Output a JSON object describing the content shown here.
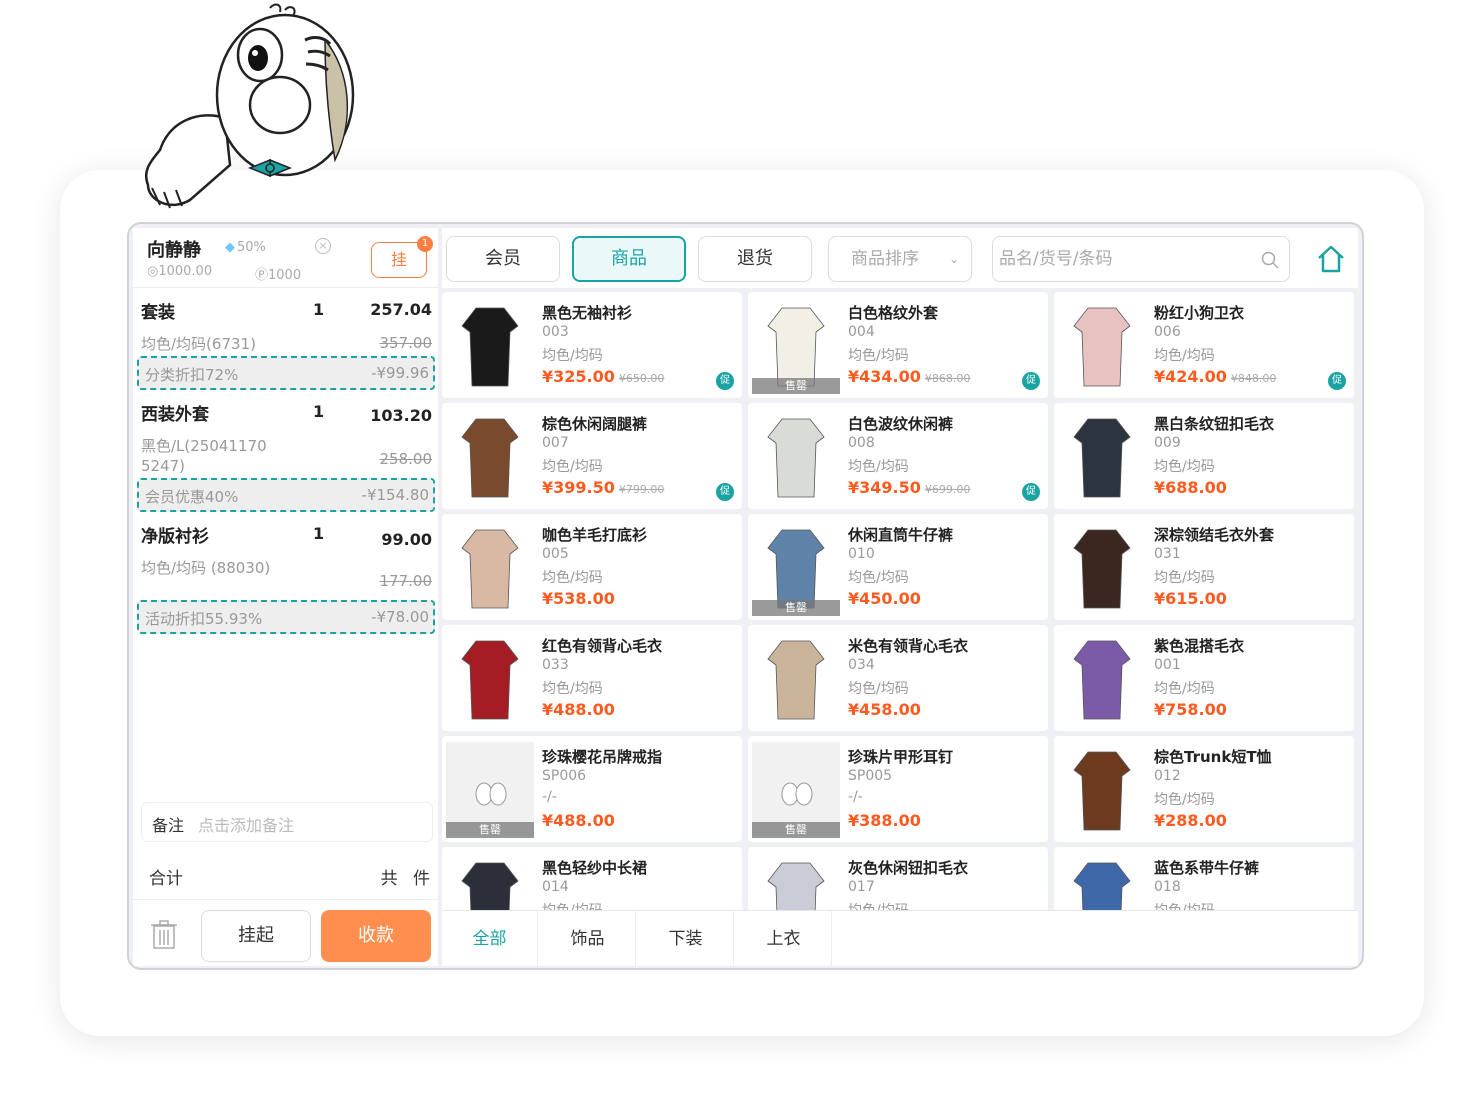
{
  "member": {
    "name": "向静静",
    "discount": "50%",
    "balance": "1000.00",
    "points": "1000",
    "hold_label": "挂",
    "hold_badge": "1"
  },
  "cart": [
    {
      "name": "套装",
      "qty": "1",
      "price": "257.04",
      "spec": "均色/均码(6731)",
      "orig": "357.00",
      "discount_label": "分类折扣72%",
      "discount_value": "-¥99.96"
    },
    {
      "name": "西装外套",
      "qty": "1",
      "price": "103.20",
      "spec": "黑色/L(25041170 5247)",
      "orig": "258.00",
      "discount_label": "会员优惠40%",
      "discount_value": "-¥154.80"
    },
    {
      "name": "净版衬衫",
      "qty": "1",
      "price": "99.00",
      "spec": "均色/均码 (88030)",
      "orig": "177.00",
      "discount_label": "活动折扣55.93%",
      "discount_value": "-¥78.00"
    }
  ],
  "remark": {
    "label": "备注",
    "placeholder": "点击添加备注"
  },
  "total": {
    "label": "合计",
    "count": "共 件"
  },
  "actions": {
    "hold": "挂起",
    "pay": "收款"
  },
  "tabs": [
    "会员",
    "商品",
    "退货"
  ],
  "sort": {
    "label": "商品排序"
  },
  "search": {
    "placeholder": "品名/货号/条码"
  },
  "products": [
    {
      "name": "黑色无袖衬衫",
      "code": "003",
      "spec": "均色/均码",
      "price": "¥325.00",
      "orig": "¥650.00",
      "promo": "促",
      "sold": ""
    },
    {
      "name": "白色格纹外套",
      "code": "004",
      "spec": "均色/均码",
      "price": "¥434.00",
      "orig": "¥868.00",
      "promo": "促",
      "sold": "售罄"
    },
    {
      "name": "粉红小狗卫衣",
      "code": "006",
      "spec": "均色/均码",
      "price": "¥424.00",
      "orig": "¥848.00",
      "promo": "促",
      "sold": ""
    },
    {
      "name": "棕色休闲阔腿裤",
      "code": "007",
      "spec": "均色/均码",
      "price": "¥399.50",
      "orig": "¥799.00",
      "promo": "促",
      "sold": ""
    },
    {
      "name": "白色波纹休闲裤",
      "code": "008",
      "spec": "均色/均码",
      "price": "¥349.50",
      "orig": "¥699.00",
      "promo": "促",
      "sold": ""
    },
    {
      "name": "黑白条纹钮扣毛衣",
      "code": "009",
      "spec": "均色/均码",
      "price": "¥688.00",
      "orig": "",
      "promo": "",
      "sold": ""
    },
    {
      "name": "咖色羊毛打底衫",
      "code": "005",
      "spec": "均色/均码",
      "price": "¥538.00",
      "orig": "",
      "promo": "",
      "sold": ""
    },
    {
      "name": "休闲直筒牛仔裤",
      "code": "010",
      "spec": "均色/均码",
      "price": "¥450.00",
      "orig": "",
      "promo": "",
      "sold": "售罄"
    },
    {
      "name": "深棕领结毛衣外套",
      "code": "031",
      "spec": "均色/均码",
      "price": "¥615.00",
      "orig": "",
      "promo": "",
      "sold": ""
    },
    {
      "name": "红色有领背心毛衣",
      "code": "033",
      "spec": "均色/均码",
      "price": "¥488.00",
      "orig": "",
      "promo": "",
      "sold": ""
    },
    {
      "name": "米色有领背心毛衣",
      "code": "034",
      "spec": "均色/均码",
      "price": "¥458.00",
      "orig": "",
      "promo": "",
      "sold": ""
    },
    {
      "name": "紫色混搭毛衣",
      "code": "001",
      "spec": "均色/均码",
      "price": "¥758.00",
      "orig": "",
      "promo": "",
      "sold": ""
    },
    {
      "name": "珍珠樱花吊牌戒指",
      "code": "SP006",
      "spec": "-/-",
      "price": "¥488.00",
      "orig": "",
      "promo": "",
      "sold": "售罄"
    },
    {
      "name": "珍珠片甲形耳钉",
      "code": "SP005",
      "spec": "-/-",
      "price": "¥388.00",
      "orig": "",
      "promo": "",
      "sold": "售罄"
    },
    {
      "name": "棕色Trunk短T恤",
      "code": "012",
      "spec": "均色/均码",
      "price": "¥288.00",
      "orig": "",
      "promo": "",
      "sold": ""
    },
    {
      "name": "黑色轻纱中长裙",
      "code": "014",
      "spec": "均色/均码",
      "price": "",
      "orig": "",
      "promo": "",
      "sold": ""
    },
    {
      "name": "灰色休闲钮扣毛衣",
      "code": "017",
      "spec": "均色/均码",
      "price": "",
      "orig": "",
      "promo": "",
      "sold": ""
    },
    {
      "name": "蓝色系带牛仔裤",
      "code": "018",
      "spec": "均色/均码",
      "price": "",
      "orig": "",
      "promo": "",
      "sold": ""
    }
  ],
  "categories": [
    "全部",
    "饰品",
    "下装",
    "上衣"
  ],
  "colors": {
    "accent": "#1ba3a3",
    "orange": "#ff8e4f",
    "price": "#ff5a1f"
  }
}
